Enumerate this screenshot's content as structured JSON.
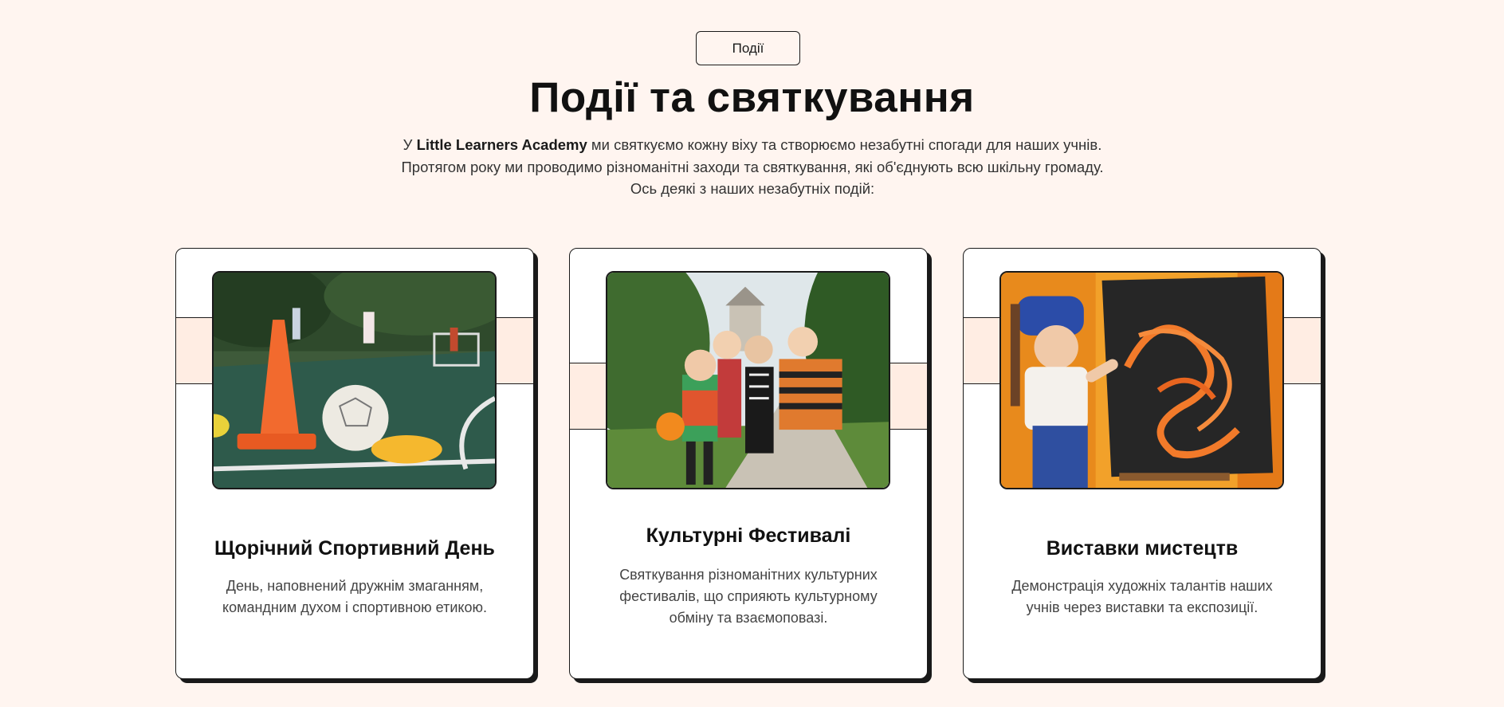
{
  "section": {
    "badge": "Події",
    "title": "Події та святкування",
    "intro_prefix": "У ",
    "intro_brand": "Little Learners Academy",
    "intro_rest": " ми святкуємо кожну віху та створюємо незабутні спогади для наших учнів. Протягом року ми проводимо різноманітні заходи та святкування, які об'єднують всю шкільну громаду. Ось деякі з наших незабутніх подій:"
  },
  "cards": [
    {
      "title": "Щорічний Спортивний День",
      "description": "День, наповнений дружнім змаганням, командним духом і спортивною етикою.",
      "image": "sports-day-photo"
    },
    {
      "title": "Культурні Фестивалі",
      "description": "Святкування різноманітних культурних фестивалів, що сприяють культурному обміну та взаємоповазі.",
      "image": "cultural-festival-photo"
    },
    {
      "title": "Виставки мистецтв",
      "description": "Демонстрація художніх талантів наших учнів через виставки та експозиції.",
      "image": "art-exhibition-photo"
    }
  ],
  "colors": {
    "background": "#FFF5F0",
    "band": "#FFEDE3",
    "border": "#1A1A1A"
  }
}
